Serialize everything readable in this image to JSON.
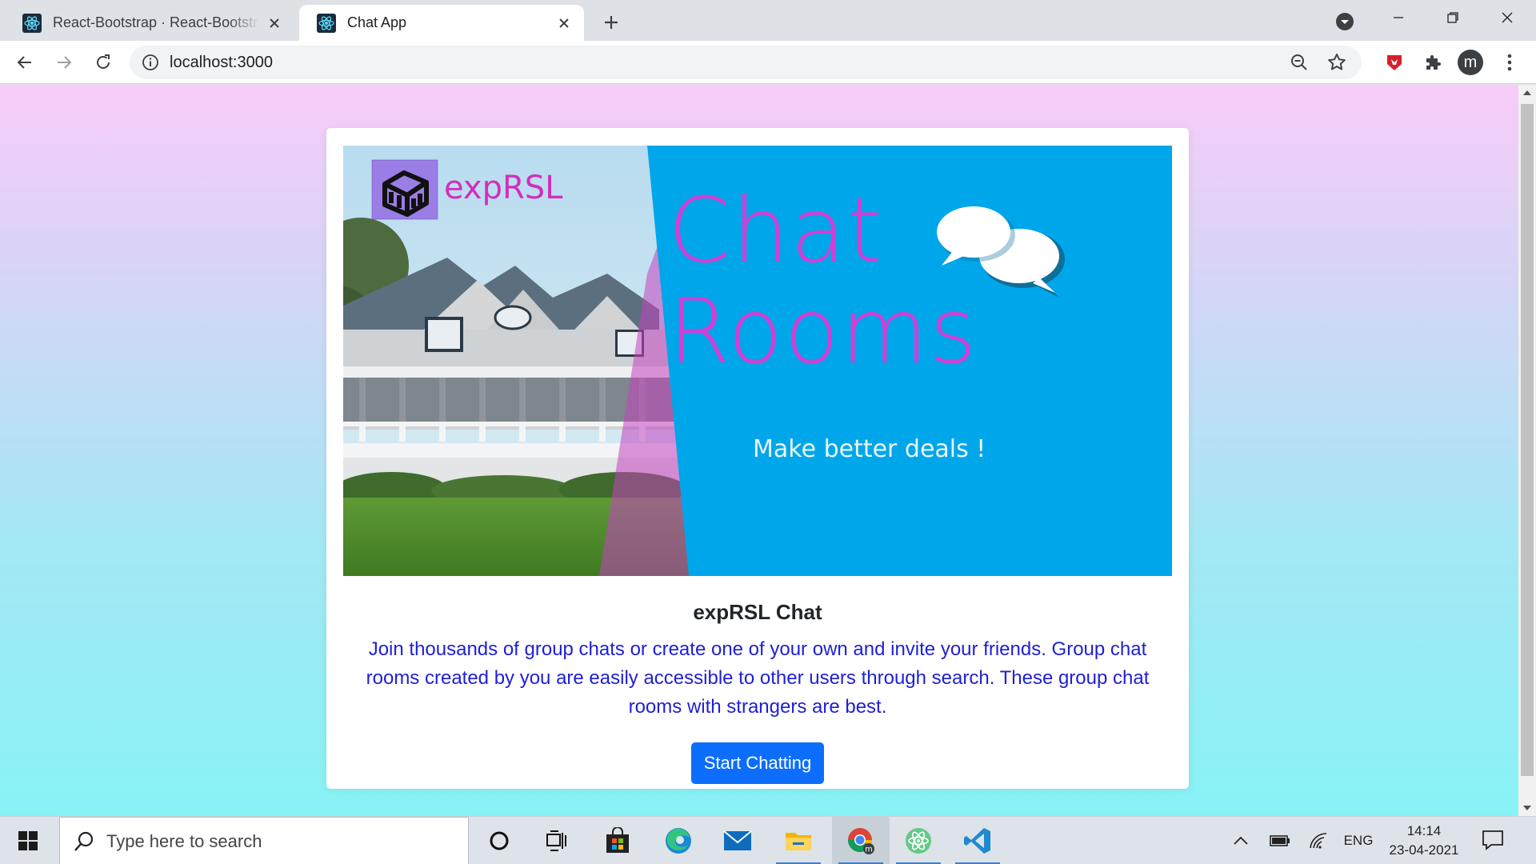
{
  "browser": {
    "tabs": [
      {
        "title": "React-Bootstrap · React-Bootstrap Documentation",
        "active": false
      },
      {
        "title": "Chat App",
        "active": true
      }
    ],
    "url": "localhost:3000",
    "profile_initial": "m"
  },
  "page": {
    "banner": {
      "brand": "expRSL",
      "heading_line1": "Chat",
      "heading_line2": "Rooms",
      "tagline": "Make better deals !"
    },
    "card": {
      "title": "expRSL Chat",
      "text": "Join thousands of group chats or create one of your own and invite your friends. Group chat rooms created by you are easily accessible to other users through search. These group chat rooms with strangers are best.",
      "button_label": "Start Chatting"
    },
    "colors": {
      "banner_blue": "#00a6ea",
      "heading_magenta": "#d23fd6",
      "body_text_blue": "#1f1fd6",
      "button_blue": "#0d6efd"
    }
  },
  "taskbar": {
    "search_placeholder": "Type here to search",
    "apps": [
      "cortana-icon",
      "task-view-icon",
      "store-icon",
      "edge-icon",
      "mail-icon",
      "file-explorer-icon",
      "chrome-icon",
      "atom-icon",
      "vscode-icon"
    ],
    "language": "ENG",
    "time": "14:14",
    "date": "23-04-2021"
  }
}
